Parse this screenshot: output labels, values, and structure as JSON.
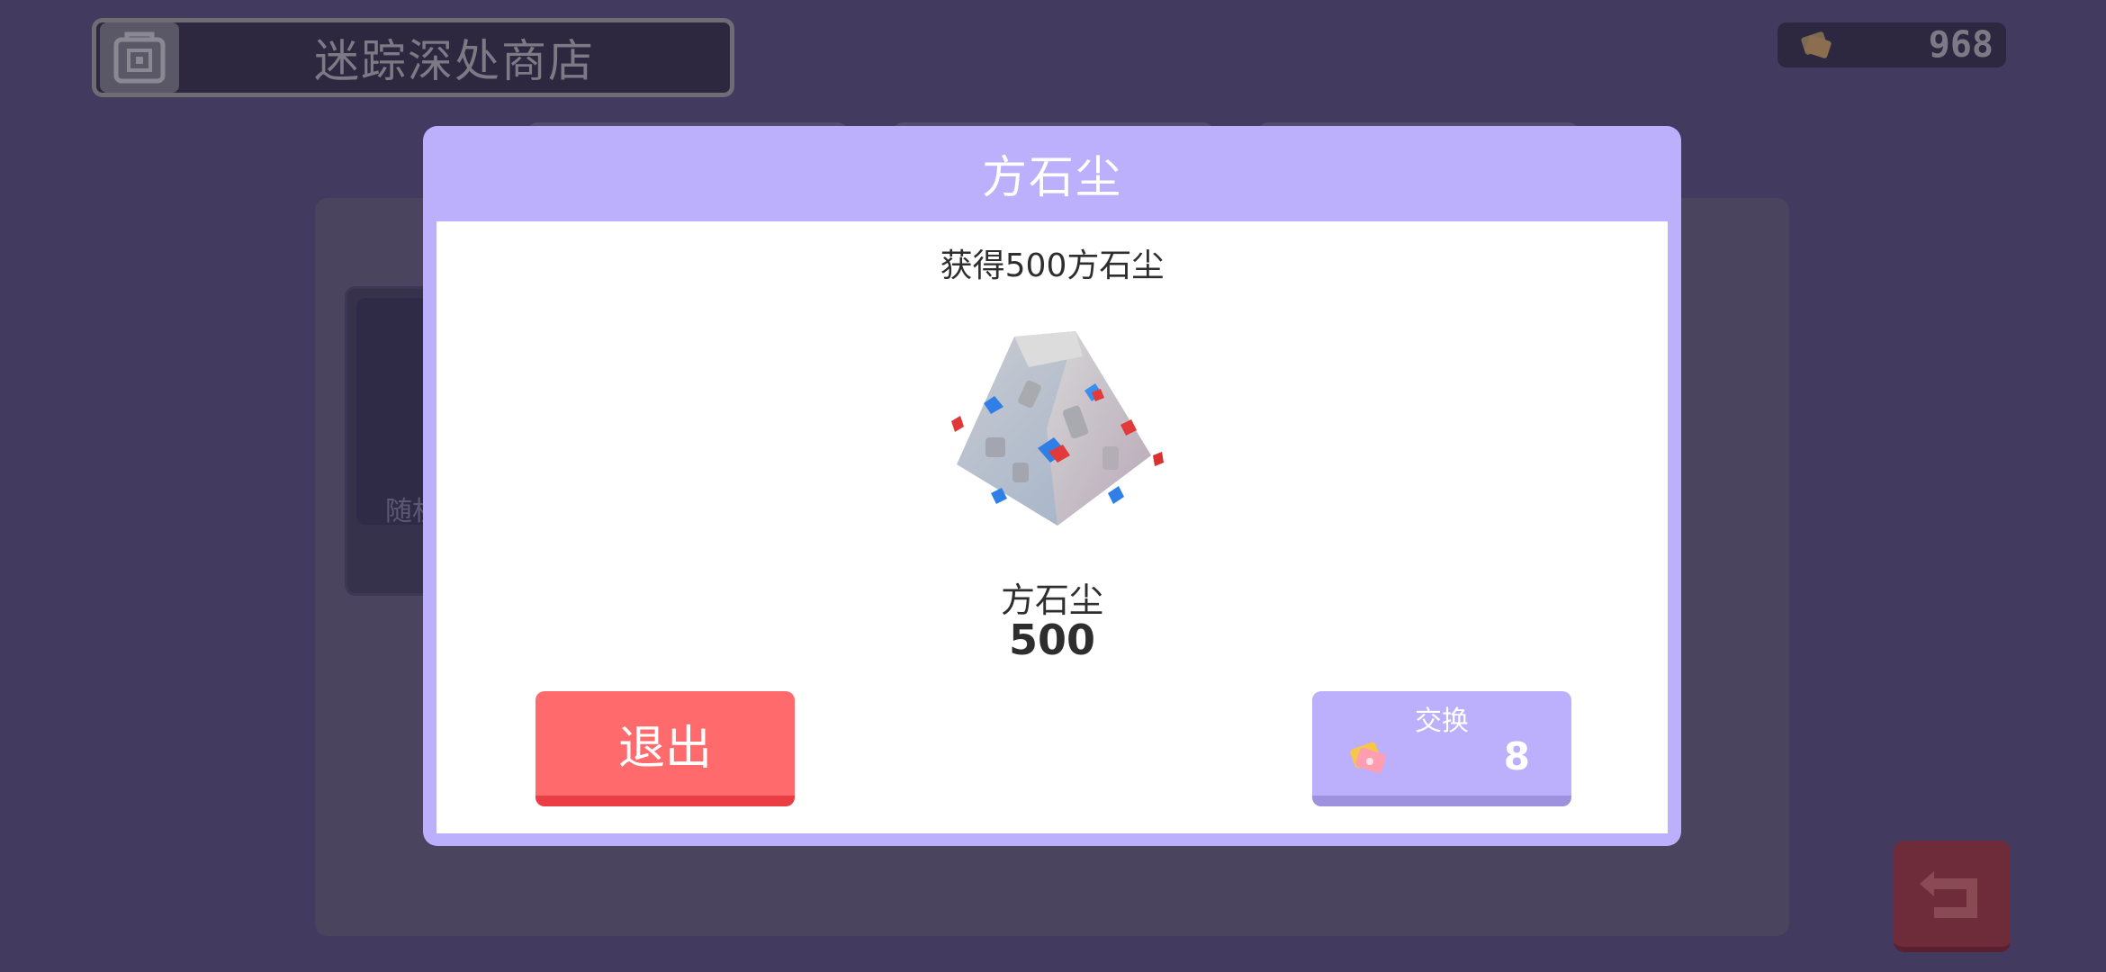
{
  "header": {
    "shop_title": "迷踪深处商店",
    "currency_amount": "968"
  },
  "background": {
    "card_label": "随机"
  },
  "dialog": {
    "title": "方石尘",
    "reward_description": "获得500方石尘",
    "item_name": "方石尘",
    "item_amount": "500",
    "exit_label": "退出",
    "exchange_label": "交换",
    "exchange_cost": "8"
  },
  "icons": {
    "currency": "ticket-icon",
    "reward": "stone-dust-icon",
    "shop": "shop-cube-icon",
    "back": "return-arrow-icon"
  },
  "colors": {
    "background": "#433a60",
    "dialog_frame": "#bcaffc",
    "exit_button": "#ff6b6d",
    "exchange_button": "#bcaffc"
  }
}
